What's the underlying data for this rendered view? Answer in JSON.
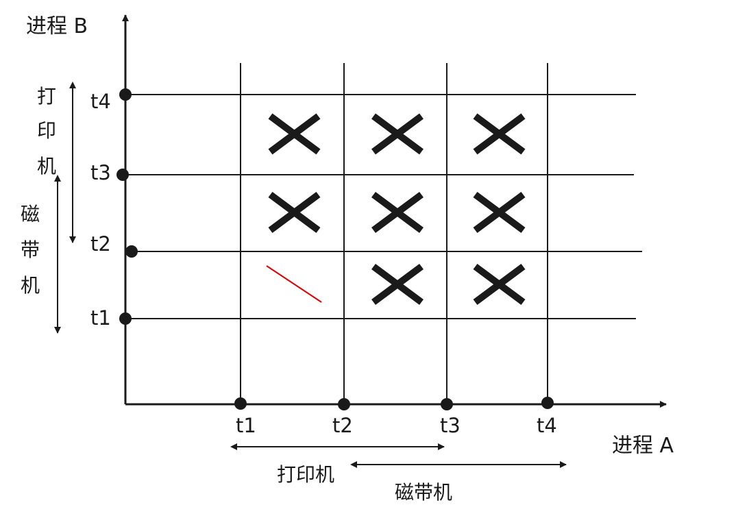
{
  "diagram": {
    "axis_x_label": "进程 A",
    "axis_y_label": "进程 B",
    "x_ticks": [
      "t1",
      "t2",
      "t3",
      "t4"
    ],
    "y_ticks": [
      "t1",
      "t2",
      "t3",
      "t4"
    ],
    "x_ranges": [
      {
        "label": "打印机",
        "from": "t1",
        "to": "t3"
      },
      {
        "label": "磁带机",
        "from": "t2",
        "to": "t4"
      }
    ],
    "y_ranges": [
      {
        "label_chars": [
          "打",
          "印",
          "机"
        ],
        "from": "t2",
        "to": "t4"
      },
      {
        "label_chars": [
          "磁",
          "带",
          "机"
        ],
        "from": "t1",
        "to": "t3"
      }
    ],
    "forbidden_cells": [
      {
        "col": 1,
        "row": 3
      },
      {
        "col": 2,
        "row": 3
      },
      {
        "col": 3,
        "row": 3
      },
      {
        "col": 1,
        "row": 2
      },
      {
        "col": 2,
        "row": 2
      },
      {
        "col": 3,
        "row": 2
      },
      {
        "col": 2,
        "row": 1
      },
      {
        "col": 3,
        "row": 1
      }
    ],
    "mark_symbol": "✕",
    "line_color": "#1a1a1a",
    "accent_color": "#e00000"
  }
}
